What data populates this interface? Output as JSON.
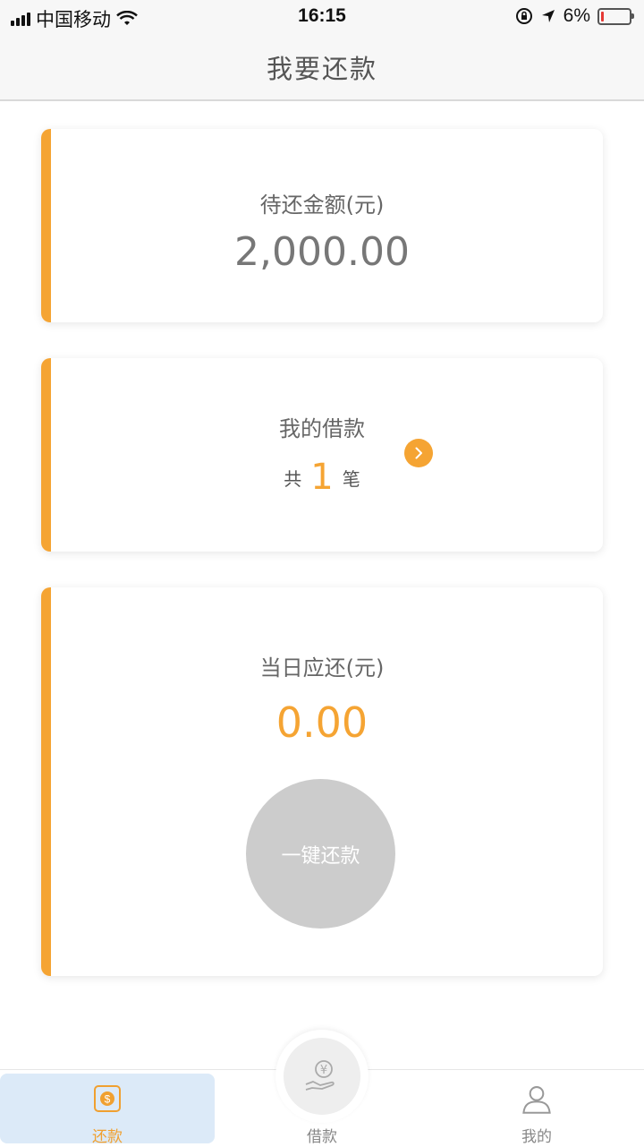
{
  "status_bar": {
    "carrier": "中国移动",
    "time": "16:15",
    "battery_percent": "6%",
    "battery_level": 0.06,
    "icons": [
      "signal-icon",
      "wifi-icon",
      "rotation-lock-icon",
      "location-arrow-icon",
      "battery-icon"
    ]
  },
  "header": {
    "title": "我要还款"
  },
  "pending_card": {
    "label": "待还金额(元)",
    "amount": "2,000.00"
  },
  "loans_card": {
    "label": "我的借款",
    "prefix": "共",
    "count": "1",
    "suffix": "笔",
    "arrow_icon": "chevron-right-icon"
  },
  "today_card": {
    "label": "当日应还(元)",
    "amount": "0.00",
    "button_label": "一键还款"
  },
  "tab_bar": {
    "tabs": [
      {
        "label": "还款",
        "icon": "dollar-coin-icon",
        "active": true
      },
      {
        "label": "借款",
        "icon": "hand-yen-icon",
        "active": false
      },
      {
        "label": "我的",
        "icon": "user-icon",
        "active": false
      }
    ]
  },
  "colors": {
    "accent": "#f5a433",
    "active_tab_bg": "#dceaf8",
    "button_disabled": "#cccccc"
  }
}
